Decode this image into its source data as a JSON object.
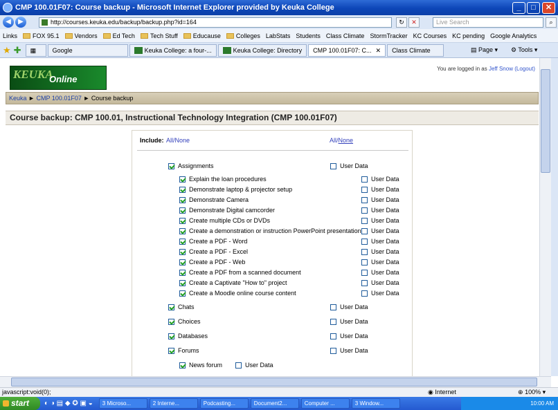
{
  "window": {
    "title": "CMP 100.01F07: Course backup - Microsoft Internet Explorer provided by Keuka College"
  },
  "address_bar": {
    "url": "http://courses.keuka.edu/backup/backup.php?id=164",
    "search_placeholder": "Live Search"
  },
  "links_bar": {
    "label": "Links",
    "items": [
      "FOX 95.1",
      "Vendors",
      "Ed Tech",
      "Tech Stuff",
      "Educause",
      "Colleges",
      "LabStats",
      "Students",
      "Class Climate",
      "StormTracker",
      "KC Courses",
      "KC pending",
      "Google Analytics"
    ]
  },
  "tabs": [
    "Google",
    "Keuka College: a four-...",
    "Keuka College: Directory",
    "CMP 100.01F07: C...",
    "Class Climate"
  ],
  "tab_controls": {
    "page": "Page",
    "tools": "Tools"
  },
  "page": {
    "logo_text": "KEUKA",
    "logo_sub": "Online",
    "logged_in_prefix": "You are logged in as",
    "user": "Jeff Snow",
    "logout": "(Logout)",
    "breadcrumb": {
      "home": "Keuka",
      "course": "CMP 100.01F07",
      "current": "Course backup",
      "sep": "►"
    },
    "heading": "Course backup: CMP 100.01, Instructional Technology Integration (CMP 100.01F07)",
    "include_label": "Include:",
    "all_none_left": {
      "all": "All",
      "none": "None"
    },
    "all_none_right": {
      "all": "All",
      "none": "None"
    },
    "user_data": "User Data",
    "modules": [
      {
        "name": "Assignments",
        "checked": true
      },
      {
        "name": "Chats",
        "checked": true
      },
      {
        "name": "Choices",
        "checked": true
      },
      {
        "name": "Databases",
        "checked": true
      },
      {
        "name": "Forums",
        "checked": true
      }
    ],
    "assignments": [
      "Explain the loan procedures",
      "Demonstrate laptop & projector setup",
      "Demonstrate Camera",
      "Demonstrate Digital camcorder",
      "Create multiple CDs or DVDs",
      "Create a demonstration or instruction PowerPoint presentation",
      "Create a PDF - Word",
      "Create a PDF - Excel",
      "Create a PDF - Web",
      "Create a PDF from a scanned document",
      "Create a Captivate \"How to\" project",
      "Create a Moodle online course content"
    ],
    "forum_items": [
      "News forum"
    ]
  },
  "status": {
    "left": "javascript:void(0);",
    "zone": "Internet",
    "zoom": "100%"
  },
  "taskbar": {
    "start": "start",
    "buttons": [
      "3 Microso...",
      "2 Interne...",
      "Podcasting...",
      "Document2...",
      "Computer ...",
      "3 Window..."
    ],
    "clock": "10:00 AM"
  }
}
